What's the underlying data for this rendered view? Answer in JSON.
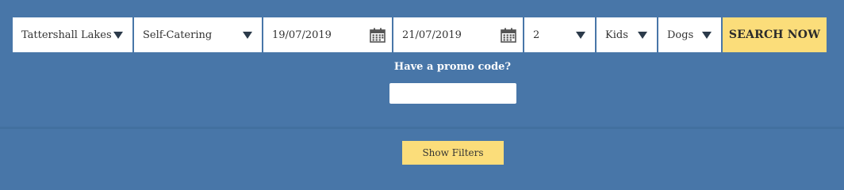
{
  "search": {
    "location": {
      "value": "Tattershall Lakes",
      "icon": "chevron-down-icon"
    },
    "accommodation_type": {
      "value": "Self-Catering",
      "icon": "chevron-down-icon"
    },
    "arrival_date": {
      "value": "19/07/2019",
      "icon": "calendar-icon"
    },
    "departure_date": {
      "value": "21/07/2019",
      "icon": "calendar-icon"
    },
    "adults": {
      "value": "2",
      "icon": "chevron-down-icon"
    },
    "kids": {
      "value": "Kids",
      "icon": "chevron-down-icon"
    },
    "dogs": {
      "value": "Dogs",
      "icon": "chevron-down-icon"
    },
    "submit_label": "SEARCH NOW"
  },
  "promo": {
    "label": "Have a promo code?",
    "value": ""
  },
  "filters": {
    "toggle_label": "Show Filters"
  },
  "colors": {
    "background": "#4876a8",
    "accent": "#fbdd7a",
    "field": "#ffffff"
  }
}
